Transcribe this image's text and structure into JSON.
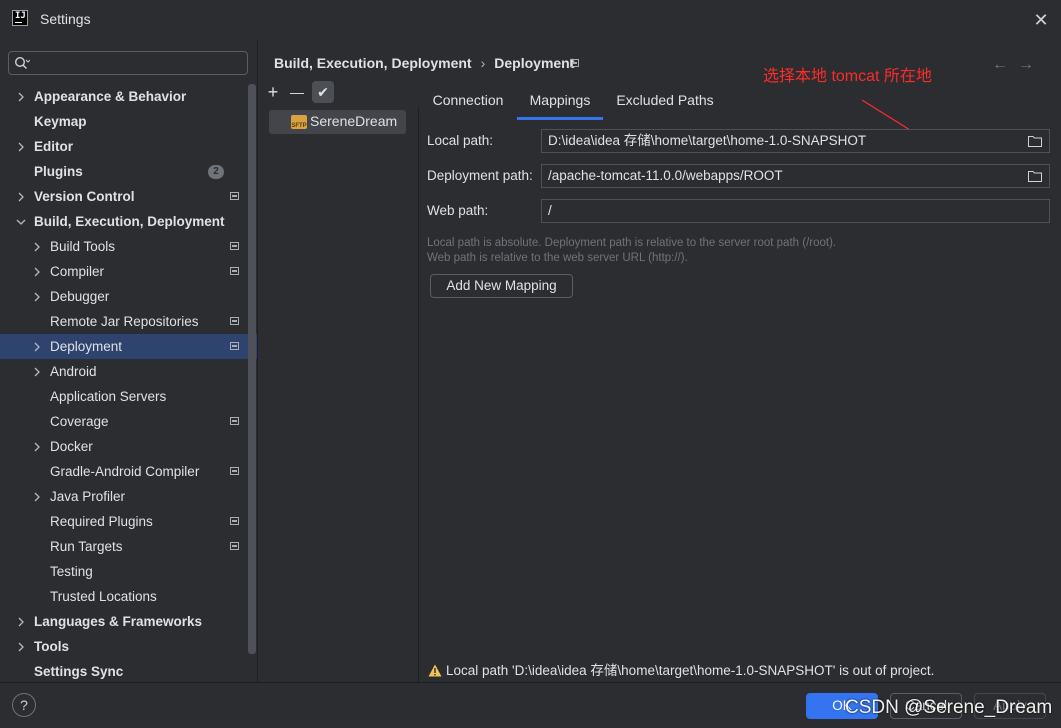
{
  "window": {
    "title": "Settings",
    "close_icon": "close-icon"
  },
  "search": {
    "placeholder": "",
    "icon": "search-icon"
  },
  "tree": [
    {
      "label": "Appearance & Behavior",
      "level": 0,
      "bold": true,
      "expandable": true,
      "expanded": false
    },
    {
      "label": "Keymap",
      "level": 0,
      "bold": true,
      "expandable": false
    },
    {
      "label": "Editor",
      "level": 0,
      "bold": true,
      "expandable": true,
      "expanded": false
    },
    {
      "label": "Plugins",
      "level": 0,
      "bold": true,
      "expandable": false,
      "badge": "2"
    },
    {
      "label": "Version Control",
      "level": 0,
      "bold": true,
      "expandable": true,
      "expanded": false,
      "project_icon": true
    },
    {
      "label": "Build, Execution, Deployment",
      "level": 0,
      "bold": true,
      "expandable": true,
      "expanded": true
    },
    {
      "label": "Build Tools",
      "level": 1,
      "expandable": true,
      "expanded": false,
      "project_icon": true
    },
    {
      "label": "Compiler",
      "level": 1,
      "expandable": true,
      "expanded": false,
      "project_icon": true
    },
    {
      "label": "Debugger",
      "level": 1,
      "expandable": true,
      "expanded": false
    },
    {
      "label": "Remote Jar Repositories",
      "level": 1,
      "expandable": false,
      "project_icon": true
    },
    {
      "label": "Deployment",
      "level": 1,
      "expandable": true,
      "expanded": false,
      "selected": true,
      "project_icon": true
    },
    {
      "label": "Android",
      "level": 1,
      "expandable": true,
      "expanded": false
    },
    {
      "label": "Application Servers",
      "level": 1,
      "expandable": false
    },
    {
      "label": "Coverage",
      "level": 1,
      "expandable": false,
      "project_icon": true
    },
    {
      "label": "Docker",
      "level": 1,
      "expandable": true,
      "expanded": false
    },
    {
      "label": "Gradle-Android Compiler",
      "level": 1,
      "expandable": false,
      "project_icon": true
    },
    {
      "label": "Java Profiler",
      "level": 1,
      "expandable": true,
      "expanded": false
    },
    {
      "label": "Required Plugins",
      "level": 1,
      "expandable": false,
      "project_icon": true
    },
    {
      "label": "Run Targets",
      "level": 1,
      "expandable": false,
      "project_icon": true
    },
    {
      "label": "Testing",
      "level": 1,
      "expandable": false
    },
    {
      "label": "Trusted Locations",
      "level": 1,
      "expandable": false
    },
    {
      "label": "Languages & Frameworks",
      "level": 0,
      "bold": true,
      "expandable": true,
      "expanded": false
    },
    {
      "label": "Tools",
      "level": 0,
      "bold": true,
      "expandable": true,
      "expanded": false
    },
    {
      "label": "Settings Sync",
      "level": 0,
      "bold": true,
      "expandable": false
    }
  ],
  "breadcrumb": {
    "parent": "Build, Execution, Deployment",
    "separator": "›",
    "current": "Deployment"
  },
  "nav": {
    "back": "←",
    "forward": "→"
  },
  "annotation": {
    "text": "选择本地 tomcat 所在地",
    "color": "#ff2a2a"
  },
  "toolbar": {
    "add": "+",
    "remove": "—",
    "check": "✔"
  },
  "servers": [
    {
      "name": "SereneDream",
      "icon": "sftp-icon"
    }
  ],
  "tabs": [
    {
      "label": "Connection",
      "active": false
    },
    {
      "label": "Mappings",
      "active": true
    },
    {
      "label": "Excluded Paths",
      "active": false
    }
  ],
  "mappings": {
    "local_path_label": "Local path:",
    "local_path_value": "D:\\idea\\idea 存储\\home\\target\\home-1.0-SNAPSHOT",
    "deployment_path_label": "Deployment path:",
    "deployment_path_value": "/apache-tomcat-11.0.0/webapps/ROOT",
    "web_path_label": "Web path:",
    "web_path_value": "/",
    "hint_line1": "Local path is absolute. Deployment path is relative to the server root path (/root).",
    "hint_line2": "Web path is relative to the web server URL (http://).",
    "add_mapping_label": "Add New Mapping",
    "warning": "Local path 'D:\\idea\\idea 存储\\home\\target\\home-1.0-SNAPSHOT' is out of project."
  },
  "footer": {
    "help": "?",
    "ok": "OK",
    "cancel": "Cancel",
    "apply": "Apply"
  },
  "watermark": "CSDN @Serene_Dream",
  "colors": {
    "accent": "#3574f0",
    "selection": "#2e436e",
    "background": "#2b2d30",
    "warning": "#f2c55c"
  }
}
